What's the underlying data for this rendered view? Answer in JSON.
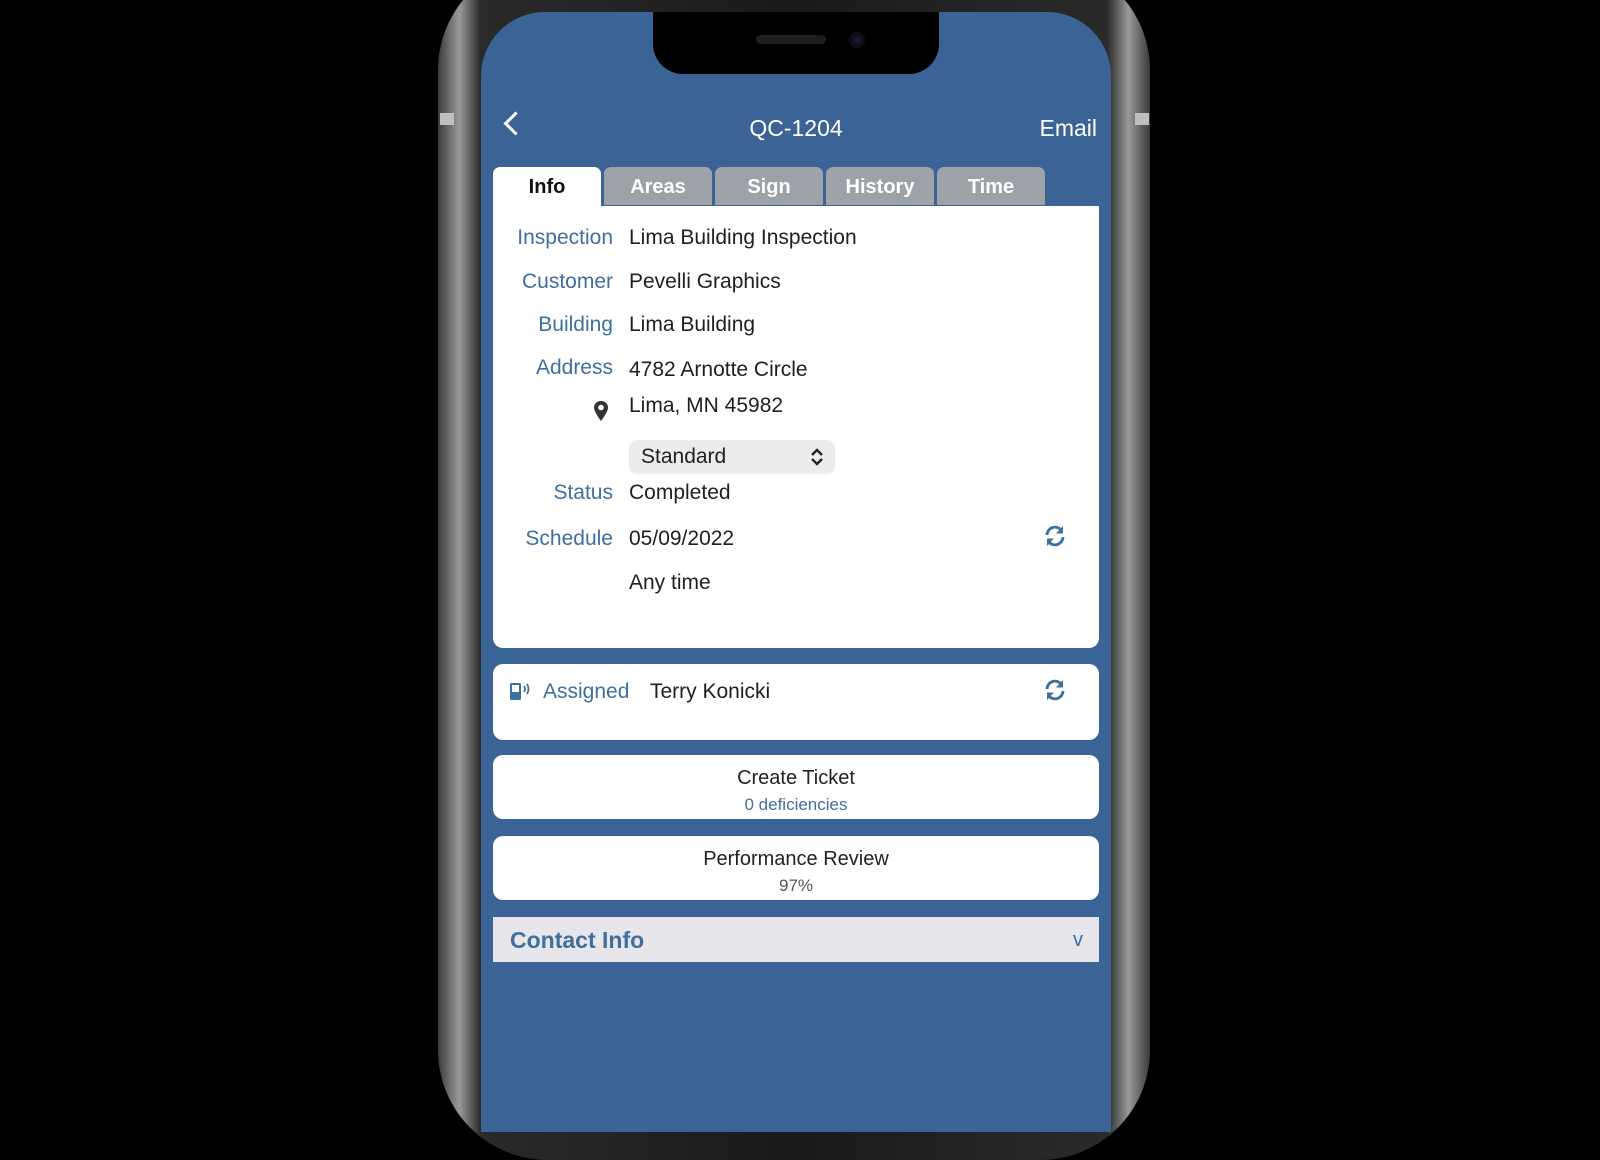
{
  "nav": {
    "title": "QC-1204",
    "right_action": "Email",
    "back_icon": "chevron-left-icon"
  },
  "tabs": [
    {
      "label": "Info",
      "active": true
    },
    {
      "label": "Areas",
      "active": false
    },
    {
      "label": "Sign",
      "active": false
    },
    {
      "label": "History",
      "active": false
    },
    {
      "label": "Time",
      "active": false
    }
  ],
  "info": {
    "inspection_label": "Inspection",
    "inspection_value": "Lima Building Inspection",
    "customer_label": "Customer",
    "customer_value": "Pevelli Graphics",
    "building_label": "Building",
    "building_value": "Lima Building",
    "address_label": "Address",
    "address_line1": "4782 Arnotte Circle",
    "address_line2": "Lima, MN 45982",
    "address_type_selected": "Standard",
    "status_label": "Status",
    "status_value": "Completed",
    "schedule_label": "Schedule",
    "schedule_date": "05/09/2022",
    "schedule_time": "Any time"
  },
  "assigned": {
    "label": "Assigned",
    "value": "Terry Konicki"
  },
  "create_ticket": {
    "title": "Create Ticket",
    "subtitle": "0 deficiencies"
  },
  "performance_review": {
    "title": "Performance Review",
    "subtitle": "97%"
  },
  "contact_info": {
    "title": "Contact Info",
    "chevron": "v"
  },
  "colors": {
    "background": "#3b6396",
    "label_blue": "#3f6f9f",
    "tab_inactive": "#9da2a8",
    "card": "#ffffff"
  }
}
